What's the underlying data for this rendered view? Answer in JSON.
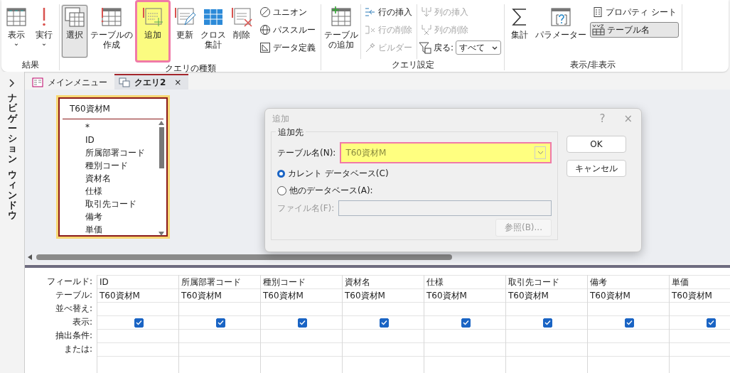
{
  "ribbon": {
    "groups": [
      {
        "label": "結果",
        "items": [
          {
            "kind": "large",
            "label": "表示",
            "dropdown": "⌄",
            "selected": false,
            "highlighted": false
          },
          {
            "kind": "large",
            "label": "実行",
            "dropdown": "⌄",
            "selected": false,
            "highlighted": false
          }
        ]
      },
      {
        "label": "クエリの種類",
        "items": [
          {
            "kind": "large",
            "label": "選択",
            "selected": true,
            "highlighted": false
          },
          {
            "kind": "large",
            "lines": [
              "テーブルの",
              "作成"
            ],
            "selected": false,
            "highlighted": false
          },
          {
            "kind": "large",
            "label": "追加",
            "selected": false,
            "highlighted": true
          },
          {
            "kind": "large",
            "label": "更新",
            "selected": false,
            "highlighted": false
          },
          {
            "kind": "large",
            "lines": [
              "クロス",
              "集計"
            ],
            "selected": false,
            "highlighted": false
          },
          {
            "kind": "large",
            "label": "削除",
            "selected": false,
            "highlighted": false
          },
          {
            "kind": "column",
            "items": [
              {
                "kind": "small",
                "label": "ユニオン",
                "disabled": false,
                "selected": false
              },
              {
                "kind": "small",
                "label": "パススルー",
                "disabled": false,
                "selected": false
              },
              {
                "kind": "small",
                "label": "データ定義",
                "disabled": false,
                "selected": false
              }
            ]
          }
        ]
      },
      {
        "label": "クエリ設定",
        "items": [
          {
            "kind": "large",
            "lines": [
              "テーブル",
              "の追加"
            ],
            "selected": false,
            "highlighted": false
          },
          {
            "kind": "column",
            "items": [
              {
                "kind": "small",
                "label": "行の挿入",
                "disabled": false,
                "selected": false
              },
              {
                "kind": "small",
                "label": "行の削除",
                "disabled": true,
                "selected": false
              },
              {
                "kind": "small",
                "label": "ビルダー",
                "disabled": true,
                "selected": false
              }
            ]
          },
          {
            "kind": "column",
            "items": [
              {
                "kind": "small",
                "label": "列の挿入",
                "disabled": true,
                "selected": false
              },
              {
                "kind": "small",
                "label": "列の削除",
                "disabled": true,
                "selected": false
              },
              {
                "kind": "combo",
                "label": "戻る:",
                "value": "すべて"
              }
            ]
          }
        ]
      },
      {
        "label": "表示/非表示",
        "items": [
          {
            "kind": "large",
            "label": "集計",
            "selected": false,
            "highlighted": false
          },
          {
            "kind": "large",
            "label": "パラメーター",
            "selected": false,
            "highlighted": false
          },
          {
            "kind": "column",
            "items": [
              {
                "kind": "small",
                "label": "プロパティ シート",
                "disabled": false,
                "selected": false
              },
              {
                "kind": "small",
                "label": "テーブル名",
                "disabled": false,
                "selected": true
              }
            ]
          }
        ]
      }
    ]
  },
  "navigation_pane": {
    "label_parts": [
      "ナビゲーション",
      "ウィンドウ"
    ]
  },
  "tabs": [
    {
      "label": "メインメニュー",
      "selected": false
    },
    {
      "label": "クエリ2",
      "selected": true,
      "close": "×"
    }
  ],
  "field_list": {
    "title": "T60資材M",
    "fields": [
      "*",
      "ID",
      "所属部署コード",
      "種別コード",
      "資材名",
      "仕様",
      "取引先コード",
      "備考",
      "単価"
    ]
  },
  "dialog": {
    "title": "追加",
    "help": "?",
    "close": "×",
    "group_label": "追加先",
    "table_label": "テーブル名(N):",
    "table_value": "T60資材M",
    "table_highlighted": true,
    "options": [
      {
        "label": "カレント データベース(C)",
        "selected": true
      },
      {
        "label": "他のデータベース(A):",
        "selected": false
      }
    ],
    "file_label": "ファイル名(F):",
    "browse": "参照(B)...",
    "buttons": [
      "OK",
      "キャンセル"
    ]
  },
  "grid": {
    "row_labels": [
      "フィールド:",
      "テーブル:",
      "並べ替え:",
      "表示:",
      "抽出条件:",
      "または:"
    ],
    "columns": [
      {
        "field": "ID",
        "table": "T60資材M",
        "show": true
      },
      {
        "field": "所属部署コード",
        "table": "T60資材M",
        "show": true
      },
      {
        "field": "種別コード",
        "table": "T60資材M",
        "show": true
      },
      {
        "field": "資材名",
        "table": "T60資材M",
        "show": true
      },
      {
        "field": "仕様",
        "table": "T60資材M",
        "show": true
      },
      {
        "field": "取引先コード",
        "table": "T60資材M",
        "show": true
      },
      {
        "field": "備考",
        "table": "T60資材M",
        "show": true
      },
      {
        "field": "単価",
        "table": "T60資材M",
        "show": true
      }
    ]
  }
}
